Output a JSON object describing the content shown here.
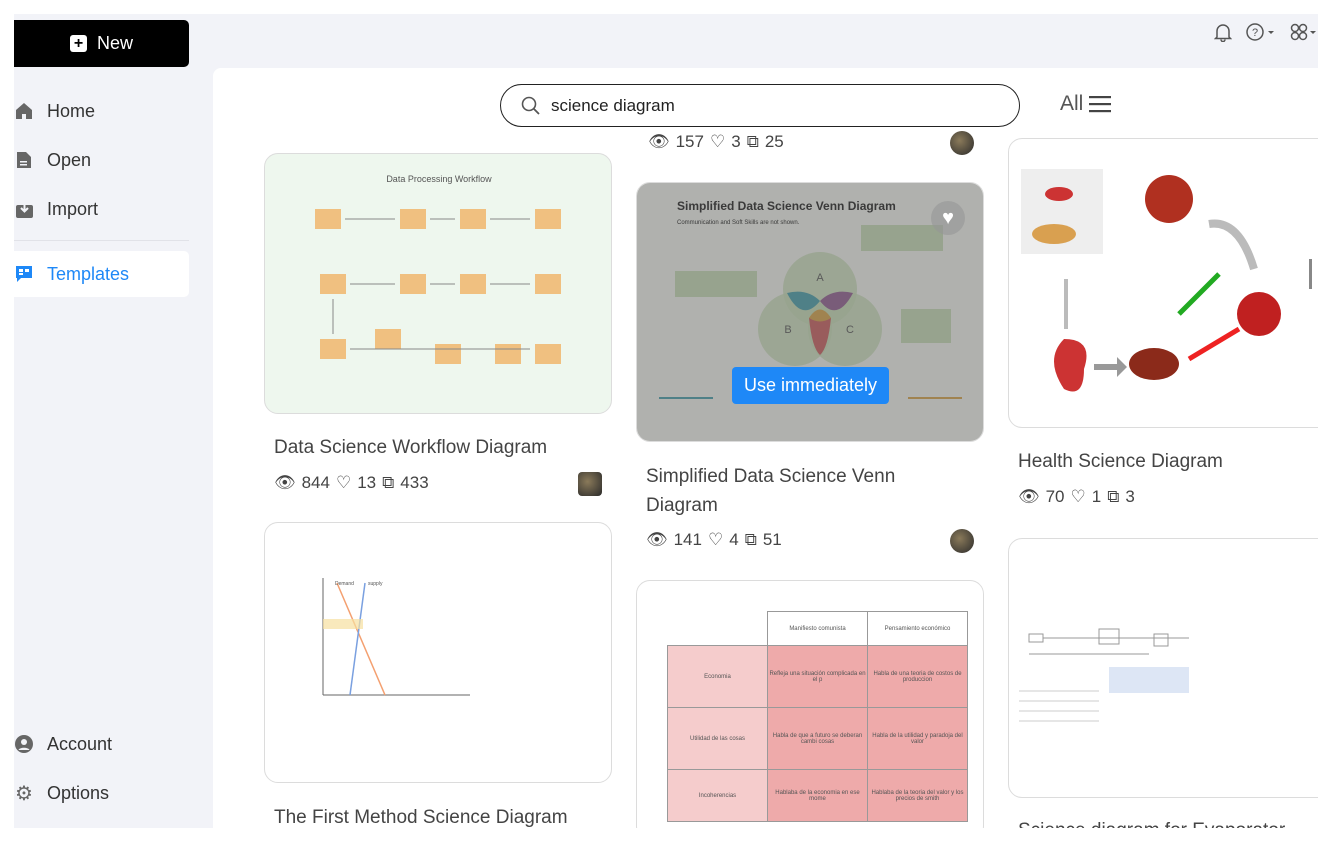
{
  "sidebar": {
    "new_label": "New",
    "items": [
      {
        "label": "Home",
        "icon": "home-icon"
      },
      {
        "label": "Open",
        "icon": "file-icon"
      },
      {
        "label": "Import",
        "icon": "import-icon"
      },
      {
        "label": "Templates",
        "icon": "templates-icon",
        "active": true
      }
    ],
    "bottom": [
      {
        "label": "Account",
        "icon": "account-icon"
      },
      {
        "label": "Options",
        "icon": "gear-icon"
      }
    ]
  },
  "topbar": {
    "icons": [
      "bell-icon",
      "help-icon",
      "apps-icon"
    ]
  },
  "search": {
    "value": "science diagram"
  },
  "filter": {
    "label": "All"
  },
  "accent": "#1e88f7",
  "cards": [
    {
      "title": "Data Science Workflow Diagram",
      "views": "844",
      "likes": "13",
      "copies": "433",
      "thumb_title": "Data Processing Workflow"
    },
    {
      "title": "Simplified Data Science Venn Diagram",
      "views": "141",
      "likes": "4",
      "copies": "51",
      "thumb_title": "Simplified Data Science Venn Diagram",
      "thumb_subtitle": "Communication and Soft Skills are not shown.",
      "hover_button": "Use immediately",
      "venn": [
        "A",
        "B",
        "C"
      ]
    },
    {
      "title": "Health Science Diagram",
      "views": "70",
      "likes": "1",
      "copies": "3"
    },
    {
      "title": "The First Method Science Diagram",
      "thumb_labels": [
        "Demand",
        "supply"
      ]
    },
    {
      "title": "Science diagram for Evaporator"
    },
    {
      "prev_stats": {
        "views": "157",
        "likes": "3",
        "copies": "25"
      },
      "table": {
        "headers": [
          "Manifiesto comunista",
          "Pensamiento económico"
        ],
        "rows": [
          [
            "Economia",
            "Refleja una situación complicada en el p",
            "Habla de una teoria de costos de produccion"
          ],
          [
            "Utilidad de las cosas",
            "Habla de que a futuro se deberan cambi cosas",
            "Habla de la utilidad y paradoja del valor"
          ],
          [
            "Incoherencias",
            "Hablaba de la economia en ese mome",
            "Hablaba de la teoria del valor y los precios de smith"
          ]
        ]
      }
    }
  ]
}
